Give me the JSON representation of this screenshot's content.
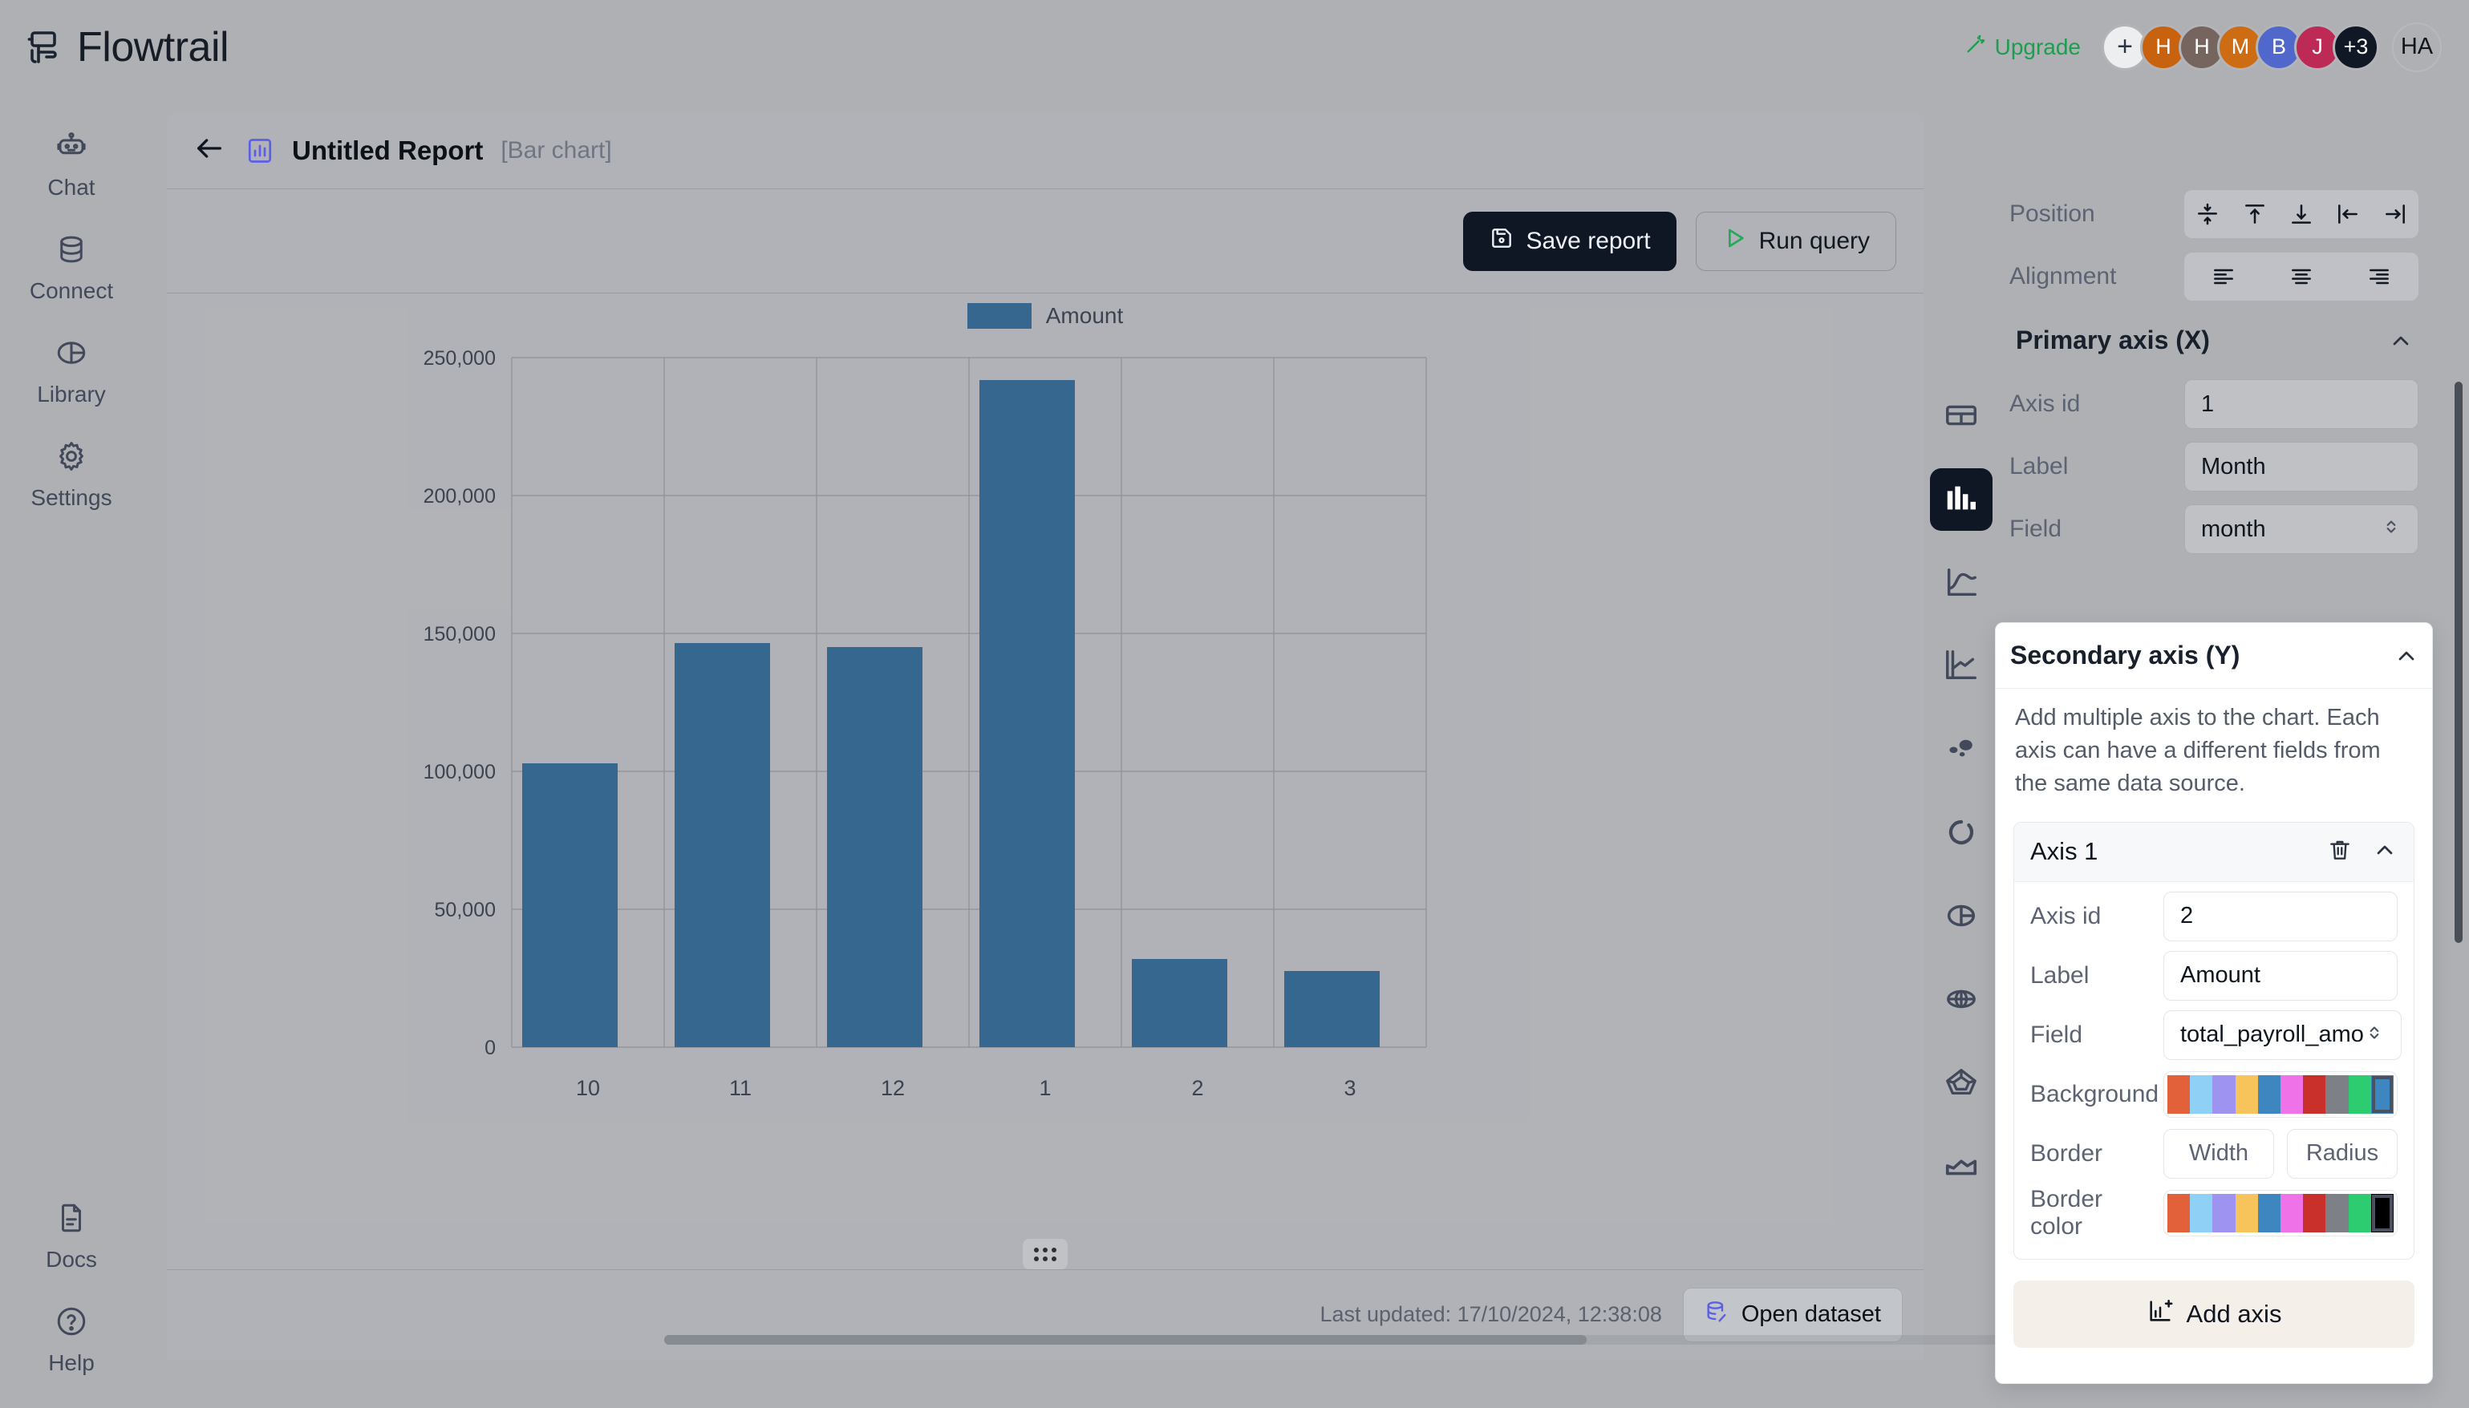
{
  "app": {
    "brand": "Flowtrail",
    "brand_icon": "flowtrail-logo-icon"
  },
  "topbar": {
    "upgrade_label": "Upgrade",
    "upgrade_icon": "magic-wand-icon",
    "add_member_label": "+",
    "avatars": [
      {
        "initial": "H",
        "color": "#c9620e"
      },
      {
        "initial": "H",
        "color": "#76655e"
      },
      {
        "initial": "M",
        "color": "#cd6c12"
      },
      {
        "initial": "B",
        "color": "#5068cc"
      },
      {
        "initial": "J",
        "color": "#bd2a55"
      },
      {
        "initial": "+3",
        "color": "#101826"
      }
    ],
    "user_avatar": "HA"
  },
  "sidebar": {
    "items": [
      {
        "label": "Chat",
        "icon": "robot-icon"
      },
      {
        "label": "Connect",
        "icon": "database-icon"
      },
      {
        "label": "Library",
        "icon": "pie-chart-icon"
      },
      {
        "label": "Settings",
        "icon": "gear-icon"
      }
    ],
    "bottom_items": [
      {
        "label": "Docs",
        "icon": "document-icon"
      },
      {
        "label": "Help",
        "icon": "question-circle-icon"
      }
    ]
  },
  "report": {
    "back_icon": "arrow-left-icon",
    "type_icon": "bar-chart-icon",
    "title": "Untitled Report",
    "subtitle": "[Bar chart]",
    "save_label": "Save report",
    "save_icon": "save-icon",
    "run_label": "Run query",
    "run_icon": "play-icon",
    "last_updated": "Last updated: 17/10/2024, 12:38:08",
    "open_dataset_label": "Open dataset",
    "open_dataset_icon": "dataset-icon"
  },
  "chart_types": [
    {
      "name": "table",
      "icon": "table-icon",
      "active": false
    },
    {
      "name": "bar",
      "icon": "bar-chart-icon",
      "active": true
    },
    {
      "name": "line",
      "icon": "line-chart-icon",
      "active": false
    },
    {
      "name": "mixed",
      "icon": "mixed-chart-icon",
      "active": false
    },
    {
      "name": "bubble",
      "icon": "bubble-chart-icon",
      "active": false
    },
    {
      "name": "doughnut",
      "icon": "doughnut-chart-icon",
      "active": false
    },
    {
      "name": "pie",
      "icon": "pie-chart-icon",
      "active": false
    },
    {
      "name": "polar",
      "icon": "polar-area-icon",
      "active": false
    },
    {
      "name": "radar",
      "icon": "radar-chart-icon",
      "active": false
    },
    {
      "name": "area",
      "icon": "area-chart-icon",
      "active": false
    }
  ],
  "chart_data": {
    "type": "bar",
    "title": "",
    "categories": [
      "10",
      "11",
      "12",
      "1",
      "2",
      "3"
    ],
    "series": [
      {
        "name": "Amount",
        "color": "#36688f",
        "values": [
          103000,
          146500,
          145000,
          242000,
          32000,
          27500
        ]
      }
    ],
    "xlabel": "Month",
    "ylabel": "Amount",
    "ylim": [
      0,
      250000
    ],
    "yticks": [
      0,
      50000,
      100000,
      150000,
      200000,
      250000
    ],
    "ytick_labels": [
      "0",
      "50,000",
      "100,000",
      "150,000",
      "200,000",
      "250,000"
    ],
    "grid": true,
    "legend_position": "top"
  },
  "settings": {
    "position": {
      "label": "Position",
      "options": [
        {
          "name": "center-vertical",
          "icon": "align-center-vertical-icon"
        },
        {
          "name": "top",
          "icon": "align-top-icon"
        },
        {
          "name": "bottom",
          "icon": "align-bottom-icon"
        },
        {
          "name": "left",
          "icon": "align-left-edge-icon"
        },
        {
          "name": "right",
          "icon": "align-right-edge-icon"
        }
      ]
    },
    "alignment": {
      "label": "Alignment",
      "options": [
        {
          "name": "align-text-left",
          "icon": "align-text-left-icon"
        },
        {
          "name": "align-text-center",
          "icon": "align-text-center-icon"
        },
        {
          "name": "align-text-right",
          "icon": "align-text-right-icon"
        }
      ]
    },
    "primary_axis": {
      "heading": "Primary axis (X)",
      "collapse_icon": "chevron-up-icon",
      "axis_id_label": "Axis id",
      "axis_id_value": "1",
      "label_label": "Label",
      "label_value": "Month",
      "field_label": "Field",
      "field_value": "month"
    },
    "secondary_axis": {
      "heading": "Secondary axis (Y)",
      "collapse_icon": "chevron-up-icon",
      "description": "Add multiple axis to the chart. Each axis can have a different fields from the same data source.",
      "axis_card": {
        "title": "Axis 1",
        "delete_icon": "trash-icon",
        "collapse_icon": "chevron-up-icon",
        "axis_id_label": "Axis id",
        "axis_id_value": "2",
        "label_label": "Label",
        "label_value": "Amount",
        "field_label": "Field",
        "field_value": "total_payroll_amo",
        "background_label": "Background",
        "background_colors": [
          "#e2603a",
          "#8ed0f6",
          "#9e93f0",
          "#f7c35b",
          "#3d86c0",
          "#ef72e8",
          "#c9302c",
          "#7d8086",
          "#2ecc71",
          "#3d86c0"
        ],
        "background_selected_index": 9,
        "border_label": "Border",
        "border_width_label": "Width",
        "border_radius_label": "Radius",
        "border_color_label": "Border color",
        "border_colors": [
          "#e2603a",
          "#8ed0f6",
          "#9e93f0",
          "#f7c35b",
          "#3d86c0",
          "#ef72e8",
          "#c9302c",
          "#7d8086",
          "#2ecc71",
          "#000000"
        ],
        "border_selected_index": 9
      },
      "add_axis_label": "Add axis",
      "add_axis_icon": "add-chart-icon"
    }
  }
}
